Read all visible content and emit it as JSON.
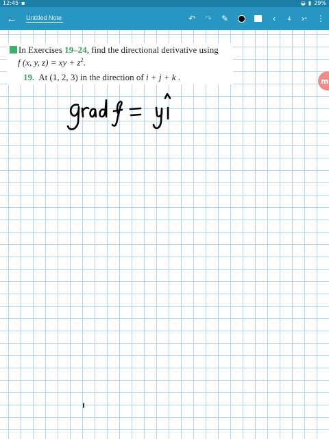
{
  "status_bar": {
    "time": "12:45",
    "battery": "29%"
  },
  "toolbar": {
    "title": "Untitled Note",
    "page_number": "4",
    "pen_color": "#000000",
    "icons": [
      "back-arrow-icon",
      "undo-icon",
      "redo-icon",
      "pen-icon",
      "color-swatch-icon",
      "image-icon",
      "prev-page-icon",
      "next-page-icon",
      "more-icon"
    ]
  },
  "problem": {
    "intro_before": "In Exercises ",
    "intro_range": "19–24",
    "intro_after": ", find the directional derivative using",
    "function_text": "f (x, y, z) = xy + z",
    "function_exp": "2",
    "function_end": ".",
    "exercise_number": "19.",
    "exercise_text": "At (1, 2, 3) in the direction of ",
    "direction_text": "i + j + k"
  },
  "handwriting": {
    "text": "grad f = y î"
  },
  "colors": {
    "status_bar": "#1e7fa6",
    "toolbar": "#2796c2",
    "grid": "#b3d4ee",
    "accent_green": "#3a9f63"
  }
}
